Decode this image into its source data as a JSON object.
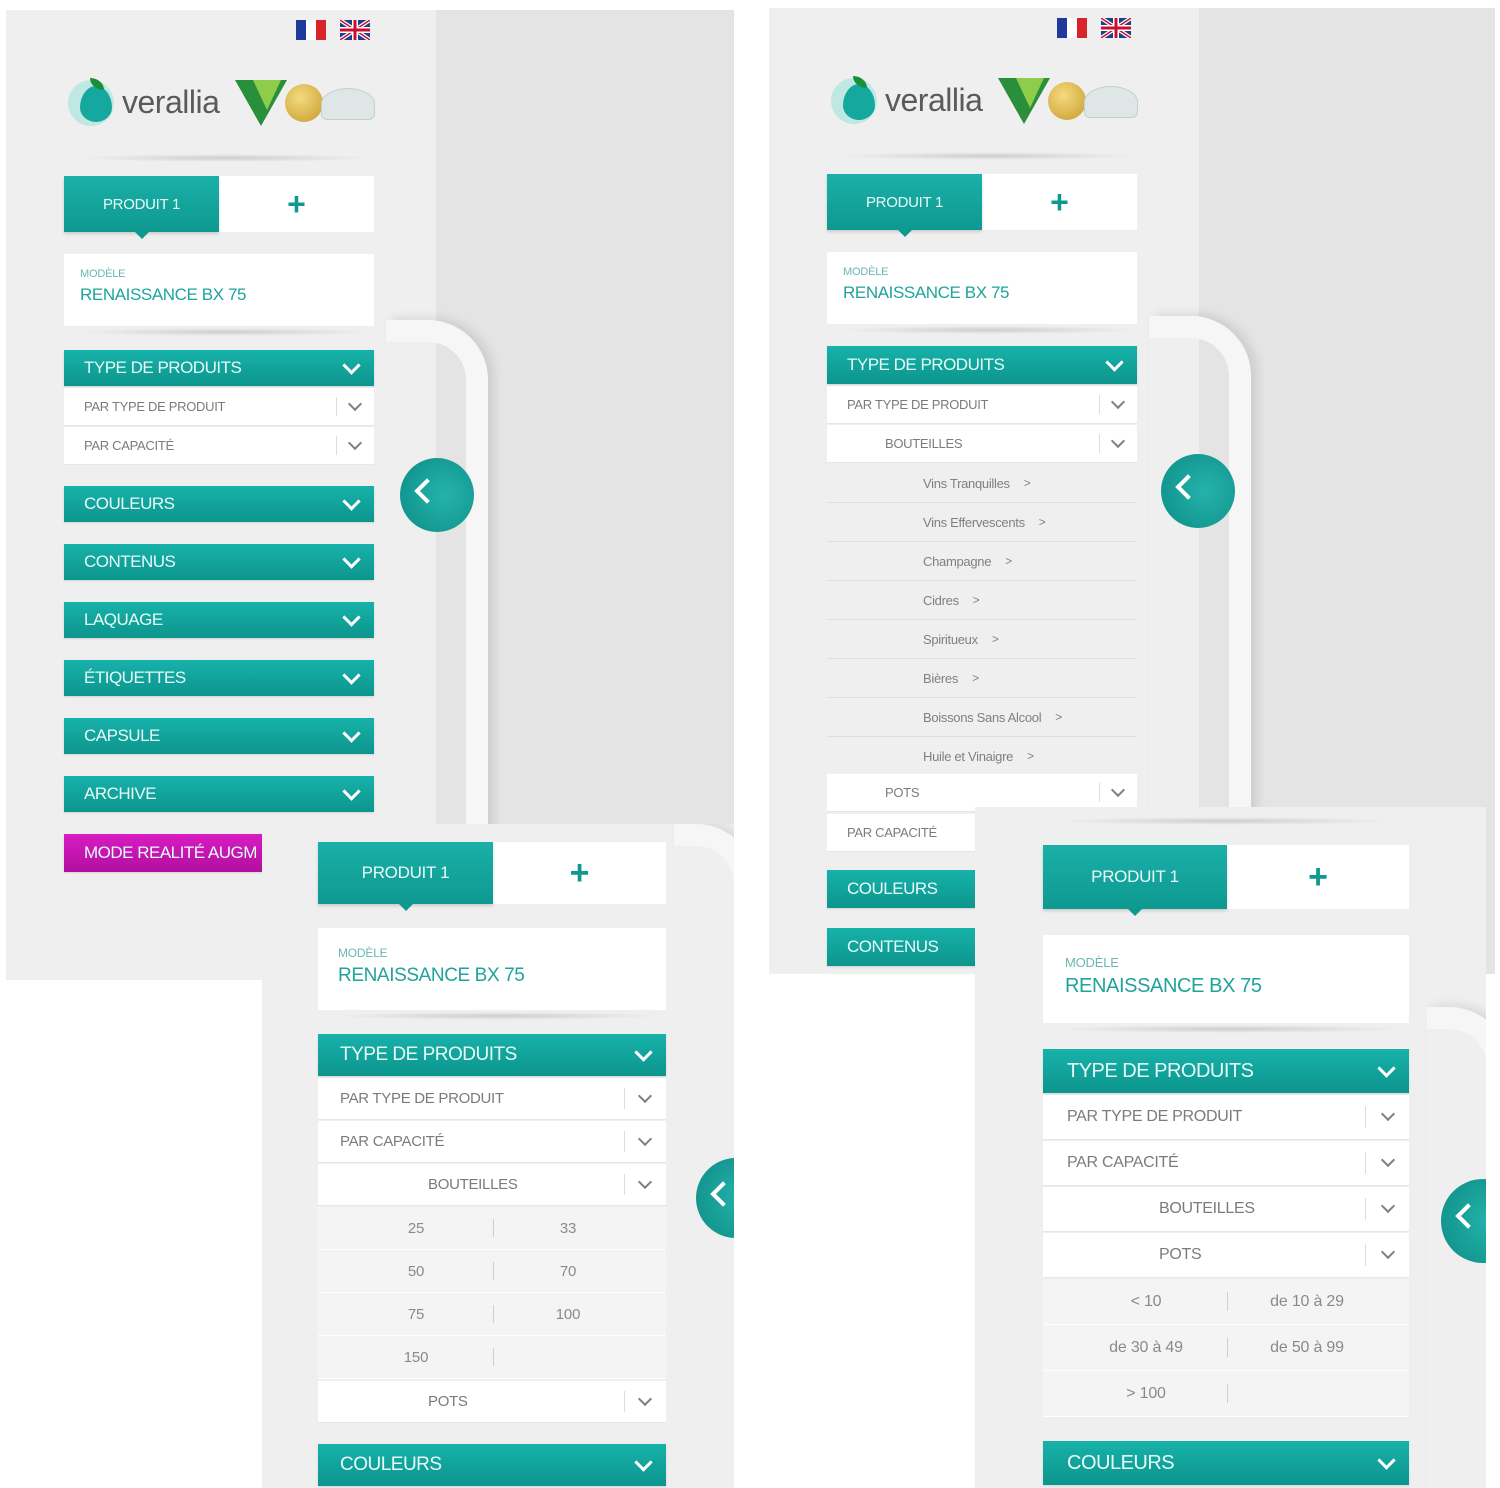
{
  "header": {
    "flags": [
      "french-flag",
      "uk-flag"
    ],
    "logo_text": "verallia"
  },
  "tabs": {
    "product_label": "PRODUIT 1",
    "add_label": "+"
  },
  "modele": {
    "label": "MODÈLE",
    "value": "RENAISSANCE BX 75"
  },
  "menu": {
    "type_de_produits": "TYPE DE PRODUITS",
    "par_type_de_produit": "PAR TYPE DE PRODUIT",
    "par_capacite": "PAR CAPACITÉ",
    "couleurs": "COULEURS",
    "contenus": "CONTENUS",
    "laquage": "LAQUAGE",
    "etiquettes": "ÉTIQUETTES",
    "capsule": "CAPSULE",
    "archive": "ARCHIVE",
    "mode_realite": "MODE REALITÉ AUGM"
  },
  "bouteilles": "BOUTEILLES",
  "pots": "POTS",
  "product_types": [
    "Vins Tranquilles",
    "Vins Effervescents",
    "Champagne",
    "Cidres",
    "Spiritueux",
    "Bières",
    "Boissons Sans Alcool",
    "Huile et Vinaigre"
  ],
  "link_arrow": ">",
  "bottle_capacities": [
    [
      "25",
      "33"
    ],
    [
      "50",
      "70"
    ],
    [
      "75",
      "100"
    ],
    [
      "150",
      ""
    ]
  ],
  "pot_capacities": [
    [
      "< 10",
      "de 10 à 29"
    ],
    [
      "de 30 à 49",
      "de 50 à 99"
    ],
    [
      "> 100",
      ""
    ]
  ],
  "colors": {
    "teal": "#12a69e",
    "magenta": "#c516b1",
    "panel": "#efefef"
  }
}
